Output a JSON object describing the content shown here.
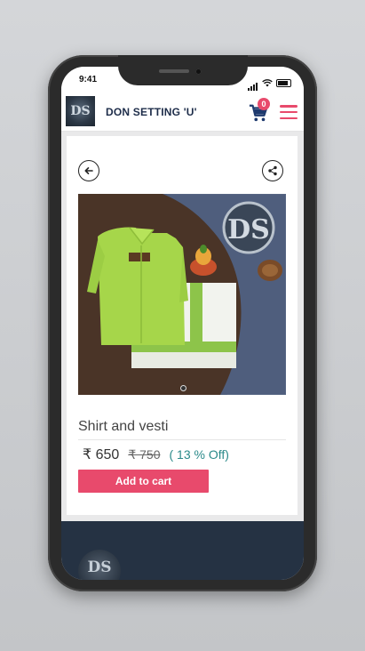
{
  "status_bar": {
    "time": "9:41"
  },
  "header": {
    "logo_text": "DS",
    "brand": "DON SETTING 'U'",
    "cart_count": "0",
    "icons": [
      "cart-icon",
      "hamburger-menu-icon"
    ]
  },
  "product": {
    "title": "Shirt and vesti",
    "price": "₹ 650",
    "original_price": "₹ 750",
    "discount": "( 13 % Off)",
    "add_to_cart_label": "Add to cart",
    "image_logo_text": "DS",
    "carousel_dots": 1
  },
  "footer": {
    "logo_text": "DS"
  },
  "colors": {
    "accent": "#e84a6c",
    "brand_text": "#1e2d4a",
    "footer_bg": "#253243",
    "discount_text": "#2b8a8a"
  }
}
